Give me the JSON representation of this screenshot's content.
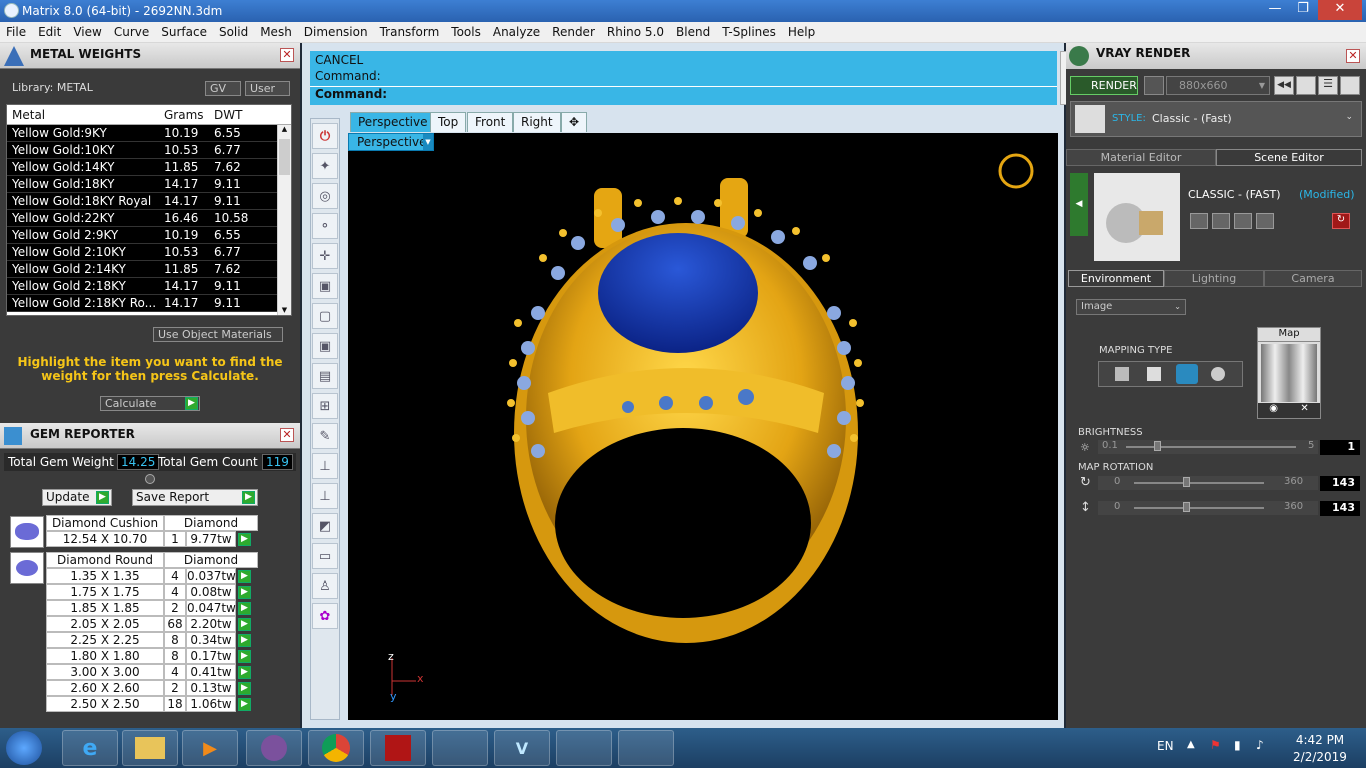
{
  "window": {
    "title": "Matrix 8.0 (64-bit) - 2692NN.3dm",
    "min": "—",
    "max": "❐",
    "close": "✕"
  },
  "menu": [
    "File",
    "Edit",
    "View",
    "Curve",
    "Surface",
    "Solid",
    "Mesh",
    "Dimension",
    "Transform",
    "Tools",
    "Analyze",
    "Render",
    "Rhino 5.0",
    "Blend",
    "T-Splines",
    "Help"
  ],
  "metal": {
    "title": "METAL WEIGHTS",
    "library": "Library: METAL",
    "gv": "GV",
    "user": "User",
    "headers": [
      "Metal",
      "Grams",
      "DWT"
    ],
    "rows": [
      [
        "Yellow Gold:9KY",
        "10.19",
        "6.55"
      ],
      [
        "Yellow Gold:10KY",
        "10.53",
        "6.77"
      ],
      [
        "Yellow Gold:14KY",
        "11.85",
        "7.62"
      ],
      [
        "Yellow Gold:18KY",
        "14.17",
        "9.11"
      ],
      [
        "Yellow Gold:18KY Royal",
        "14.17",
        "9.11"
      ],
      [
        "Yellow Gold:22KY",
        "16.46",
        "10.58"
      ],
      [
        "Yellow Gold 2:9KY",
        "10.19",
        "6.55"
      ],
      [
        "Yellow Gold 2:10KY",
        "10.53",
        "6.77"
      ],
      [
        "Yellow Gold 2:14KY",
        "11.85",
        "7.62"
      ],
      [
        "Yellow Gold 2:18KY",
        "14.17",
        "9.11"
      ],
      [
        "Yellow Gold 2:18KY Ro...",
        "14.17",
        "9.11"
      ]
    ],
    "use_obj": "Use Object Materials",
    "hint": "Highlight the item you want to find the weight for then press Calculate.",
    "calculate": "Calculate"
  },
  "gem": {
    "title": "GEM REPORTER",
    "weight_label": "Total Gem Weight",
    "weight": "14.25",
    "count_label": "Total Gem Count",
    "count": "119",
    "update": "Update",
    "save": "Save Report",
    "groups": [
      {
        "name": "Diamond Cushion",
        "type": "Diamond",
        "rows": [
          [
            "12.54 X 10.70",
            "1",
            "9.77tw"
          ]
        ]
      },
      {
        "name": "Diamond Round",
        "type": "Diamond",
        "rows": [
          [
            "1.35 X 1.35",
            "4",
            "0.037tw"
          ],
          [
            "1.75 X 1.75",
            "4",
            "0.08tw"
          ],
          [
            "1.85 X 1.85",
            "2",
            "0.047tw"
          ],
          [
            "2.05 X 2.05",
            "68",
            "2.20tw"
          ],
          [
            "2.25 X 2.25",
            "8",
            "0.34tw"
          ],
          [
            "1.80 X 1.80",
            "8",
            "0.17tw"
          ],
          [
            "3.00 X 3.00",
            "4",
            "0.41tw"
          ],
          [
            "2.60 X 2.60",
            "2",
            "0.13tw"
          ],
          [
            "2.50 X 2.50",
            "18",
            "1.06tw"
          ]
        ]
      }
    ]
  },
  "command": {
    "line1": "CANCEL",
    "line2": "Command:",
    "prompt": "Command:"
  },
  "tabs": [
    "Perspective",
    "Top",
    "Front",
    "Right",
    "✥"
  ],
  "viewport": {
    "label": "Perspective",
    "axis_z": "z",
    "axis_x": "x",
    "axis_y": "y"
  },
  "vray": {
    "title": "VRAY RENDER",
    "render": "RENDER",
    "res": "880x660",
    "style_label": "STYLE:",
    "style": "Classic - (Fast)",
    "tab_mat": "Material Editor",
    "tab_scene": "Scene Editor",
    "scene_name": "CLASSIC - (FAST)",
    "modified": "(Modified)",
    "tabs2": [
      "Environment",
      "Lighting",
      "Camera"
    ],
    "env_type": "Image",
    "map": "Map",
    "mapping": "MAPPING TYPE",
    "brightness": "BRIGHTNESS",
    "b_min": "0.1",
    "b_max": "5",
    "b_val": "1",
    "rotation": "MAP ROTATION",
    "r_min": "0",
    "r_max": "360",
    "r1": "143",
    "r2": "143"
  },
  "taskbar": {
    "lang": "EN",
    "time": "4:42 PM",
    "date": "2/2/2019"
  },
  "colors": {
    "gold": "#e8a317",
    "cmd": "#39b6e6"
  }
}
